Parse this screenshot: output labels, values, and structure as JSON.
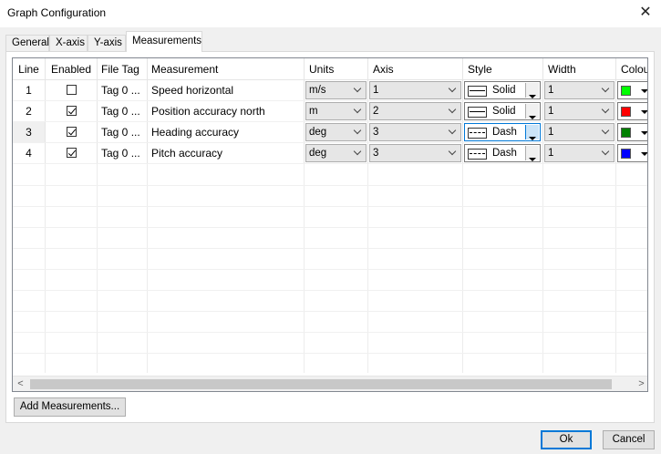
{
  "window": {
    "title": "Graph Configuration",
    "close_glyph": "✕"
  },
  "tabs": [
    {
      "label": "General",
      "active": false
    },
    {
      "label": "X-axis",
      "active": false
    },
    {
      "label": "Y-axis",
      "active": false
    },
    {
      "label": "Measurements",
      "active": true
    }
  ],
  "grid": {
    "headers": {
      "line": "Line",
      "enabled": "Enabled",
      "file_tag": "File Tag",
      "measurement": "Measurement",
      "units": "Units",
      "axis": "Axis",
      "style": "Style",
      "width": "Width",
      "colour": "Colour"
    },
    "rows": [
      {
        "line": "1",
        "enabled": false,
        "file_tag": "Tag 0 ...",
        "measurement": "Speed horizontal",
        "units": "m/s",
        "axis": "1",
        "style": "Solid",
        "style_icon": "solid-line-icon",
        "width": "1",
        "colour": "#00ff00"
      },
      {
        "line": "2",
        "enabled": true,
        "file_tag": "Tag 0 ...",
        "measurement": "Position accuracy north",
        "units": "m",
        "axis": "2",
        "style": "Solid",
        "style_icon": "solid-line-icon",
        "width": "1",
        "colour": "#ff0000"
      },
      {
        "line": "3",
        "enabled": true,
        "file_tag": "Tag 0 ...",
        "measurement": "Heading accuracy",
        "units": "deg",
        "axis": "3",
        "style": "Dash",
        "style_icon": "dashed-line-icon",
        "width": "1",
        "colour": "#008000"
      },
      {
        "line": "4",
        "enabled": true,
        "file_tag": "Tag 0 ...",
        "measurement": "Pitch accuracy",
        "units": "deg",
        "axis": "3",
        "style": "Dash",
        "style_icon": "dashed-line-icon",
        "width": "1",
        "colour": "#0000ff"
      }
    ],
    "scroll_left_glyph": "<",
    "scroll_right_glyph": ">"
  },
  "buttons": {
    "add_measurements": "Add Measurements...",
    "ok": "Ok",
    "cancel": "Cancel"
  }
}
